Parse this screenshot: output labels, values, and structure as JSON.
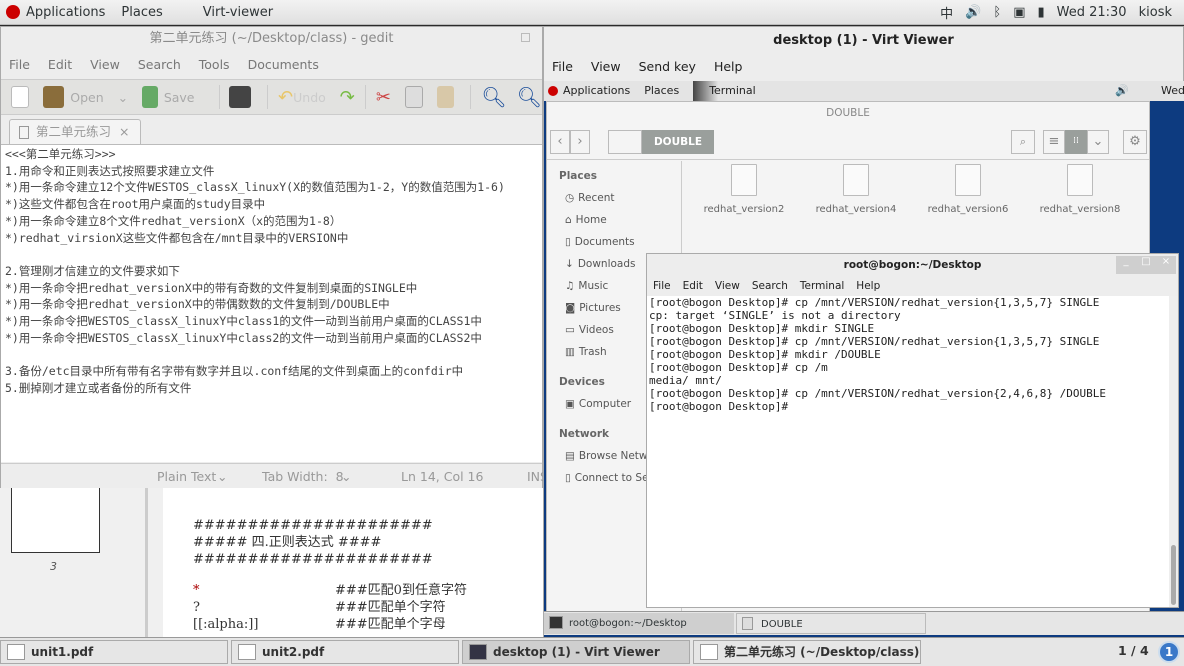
{
  "host_topbar": {
    "applications": "Applications",
    "places": "Places",
    "app": "Virt-viewer",
    "input_method": "中",
    "clock": "Wed 21:30",
    "user": "kiosk"
  },
  "gedit": {
    "title": "第二单元练习 (~/Desktop/class) - gedit",
    "menu": [
      "File",
      "Edit",
      "View",
      "Search",
      "Tools",
      "Documents"
    ],
    "toolbar": {
      "open": "Open",
      "save": "Save",
      "undo": "Undo"
    },
    "tab": "第二单元练习",
    "lines": [
      "<<<第二单元练习>>>",
      "1.用命令和正则表达式按照要求建立文件",
      "*)用一条命令建立12个文件WESTOS_classX_linuxY(X的数值范围为1-2，Y的数值范围为1-6)",
      "*)这些文件都包含在root用户桌面的study目录中",
      "*)用一条命令建立8个文件redhat_versionX（x的范围为1-8）",
      "*)redhat_virsionX这些文件都包含在/mnt目录中的VERSION中",
      "",
      "2.管理刚才信建立的文件要求如下",
      "*)用一条命令把redhat_versionX中的带有奇数的文件复制到桌面的SINGLE中",
      "*)用一条命令把redhat_versionX中的带偶数数的文件复制到/DOUBLE中",
      "*)用一条命令把WESTOS_classX_linuxY中class1的文件一动到当前用户桌面的CLASS1中",
      "*)用一条命令把WESTOS_classX_linuxY中class2的文件一动到当前用户桌面的CLASS2中",
      "",
      "3.备份/etc目录中所有带有名字带有数字并且以.conf结尾的文件到桌面上的confdir中",
      "5.删掉刚才建立或者备份的所有文件"
    ],
    "status": {
      "lang": "Plain Text",
      "tab_width": "Tab Width:  8",
      "position": "Ln 14, Col 16",
      "mode": "INS"
    }
  },
  "pdf": {
    "page_label": "3",
    "lines": [
      "######################",
      "##### 四.正则表达式 ####",
      "######################"
    ],
    "rows": [
      {
        "pat": "*",
        "desc": "###匹配0到任意字符"
      },
      {
        "pat": "?",
        "desc": "###匹配单个字符"
      },
      {
        "pat": "[[:alpha:]]",
        "desc": "###匹配单个字母"
      }
    ]
  },
  "virt": {
    "title": "desktop (1) - Virt Viewer",
    "menu": [
      "File",
      "View",
      "Send key",
      "Help"
    ]
  },
  "guest_topbar": {
    "applications": "Applications",
    "places": "Places",
    "app": "Terminal",
    "clock": "Wed"
  },
  "nautilus": {
    "title": "DOUBLE",
    "path": "DOUBLE",
    "sidebar": [
      {
        "type": "header",
        "label": "Places"
      },
      {
        "label": "Recent",
        "icon": "clock-icon"
      },
      {
        "label": "Home",
        "icon": "home-icon"
      },
      {
        "label": "Documents",
        "icon": "document-icon"
      },
      {
        "label": "Downloads",
        "icon": "download-icon"
      },
      {
        "label": "Music",
        "icon": "music-icon"
      },
      {
        "label": "Pictures",
        "icon": "camera-icon"
      },
      {
        "label": "Videos",
        "icon": "video-icon"
      },
      {
        "label": "Trash",
        "icon": "trash-icon"
      },
      {
        "type": "header",
        "label": "Devices"
      },
      {
        "label": "Computer",
        "icon": "disk-icon"
      },
      {
        "type": "header",
        "label": "Network"
      },
      {
        "label": "Browse Network",
        "icon": "network-icon"
      },
      {
        "label": "Connect to Server",
        "icon": "server-icon"
      }
    ],
    "files": [
      "redhat_version2",
      "redhat_version4",
      "redhat_version6",
      "redhat_version8"
    ]
  },
  "terminal": {
    "title": "root@bogon:~/Desktop",
    "menu": [
      "File",
      "Edit",
      "View",
      "Search",
      "Terminal",
      "Help"
    ],
    "lines": [
      "[root@bogon Desktop]# cp /mnt/VERSION/redhat_version{1,3,5,7} SINGLE",
      "cp: target ‘SINGLE’ is not a directory",
      "[root@bogon Desktop]# mkdir SINGLE",
      "[root@bogon Desktop]# cp /mnt/VERSION/redhat_version{1,3,5,7} SINGLE",
      "[root@bogon Desktop]# mkdir /DOUBLE",
      "[root@bogon Desktop]# cp /m",
      "media/ mnt/",
      "[root@bogon Desktop]# cp /mnt/VERSION/redhat_version{2,4,6,8} /DOUBLE",
      "[root@bogon Desktop]# "
    ]
  },
  "guest_taskbar": [
    "root@bogon:~/Desktop",
    "DOUBLE"
  ],
  "host_taskbar": {
    "items": [
      "unit1.pdf",
      "unit2.pdf",
      "desktop (1) - Virt Viewer",
      "第二单元练习 (~/Desktop/class) -..."
    ],
    "workspace": "1 / 4",
    "notifications": "1"
  },
  "colors": {
    "guest_desktop": "#0d3b80",
    "redhat": "#cc0000"
  }
}
